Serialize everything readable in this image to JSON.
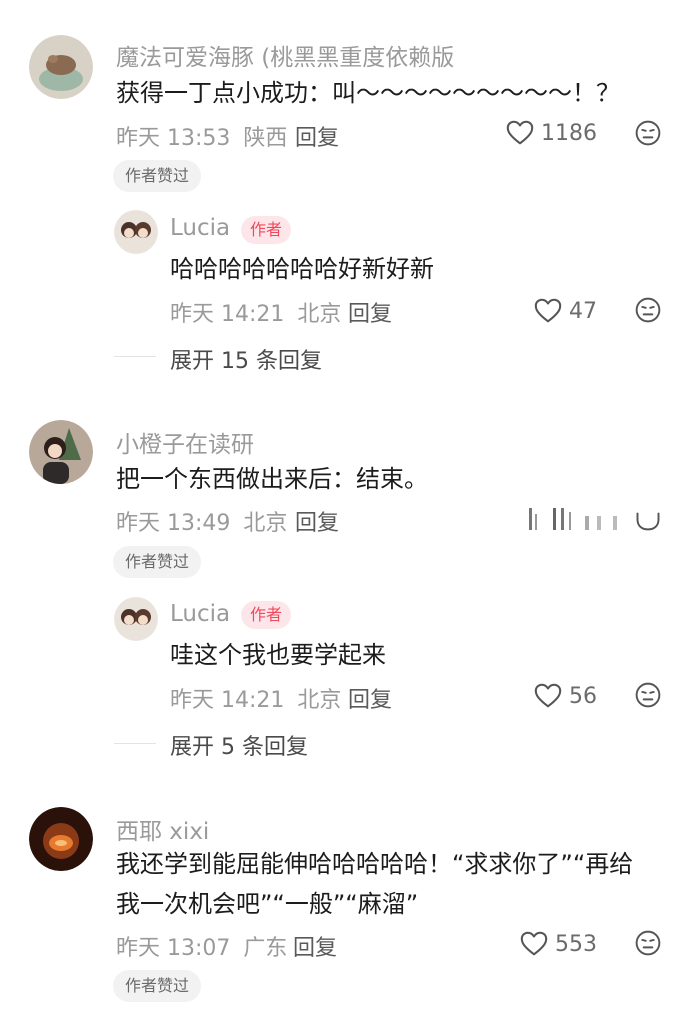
{
  "comments": [
    {
      "username": "魔法可爱海豚 (桃黑黑重度依赖版",
      "text": "获得一丁点小成功：叫～～～～～～～～～！？",
      "time": "昨天 13:53",
      "location": "陕西",
      "reply_label": "回复",
      "likes": "1186",
      "author_liked": "作者赞过",
      "reply": {
        "username": "Lucia",
        "author_tag": "作者",
        "text": "哈哈哈哈哈哈哈好新好新",
        "time": "昨天 14:21",
        "location": "北京",
        "reply_label": "回复",
        "likes": "47"
      },
      "expand": "展开 15 条回复"
    },
    {
      "username": "小橙子在读研",
      "text": "把一个东西做出来后：结束。",
      "time": "昨天 13:49",
      "location": "北京",
      "reply_label": "回复",
      "author_liked": "作者赞过",
      "reply": {
        "username": "Lucia",
        "author_tag": "作者",
        "text": "哇这个我也要学起来",
        "time": "昨天 14:21",
        "location": "北京",
        "reply_label": "回复",
        "likes": "56"
      },
      "expand": "展开 5 条回复"
    },
    {
      "username": "西耶 xixi",
      "text_line1": "我还学到能屈能伸哈哈哈哈哈！“求求你了”“再给",
      "text_line2": "我一次机会吧”“一般”“麻溜”",
      "time": "昨天 13:07",
      "location": "广东",
      "reply_label": "回复",
      "likes": "553",
      "author_liked": "作者赞过"
    }
  ],
  "icons": {
    "like": "heart-outline-icon",
    "dislike": "dislike-face-icon"
  },
  "colors": {
    "author_tag_bg": "#fde6ea",
    "author_tag_text": "#f2485c",
    "meta": "#9a9a9a"
  }
}
